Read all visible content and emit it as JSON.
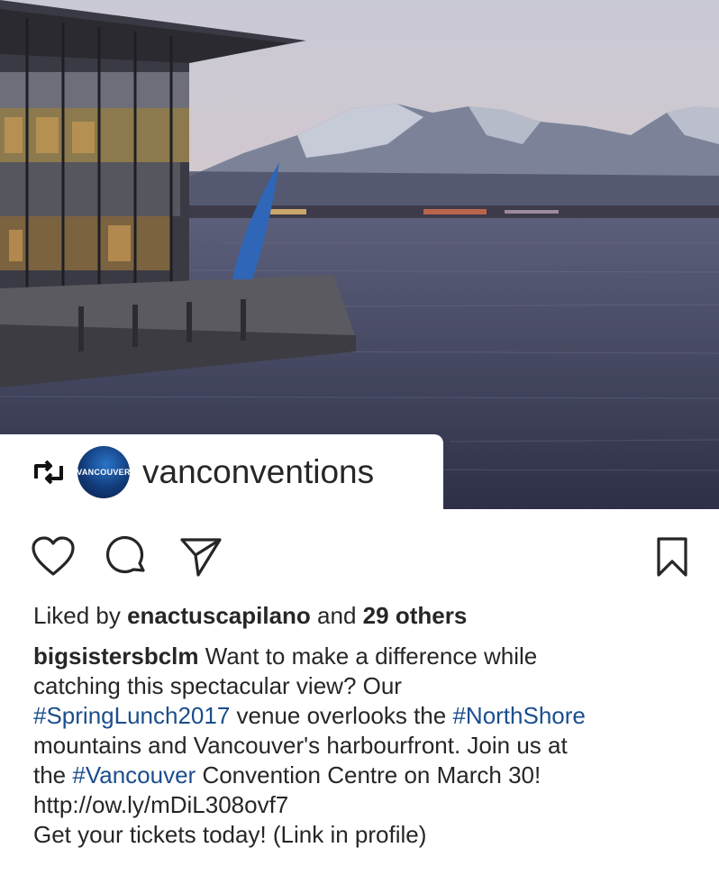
{
  "repost": {
    "username": "vanconventions",
    "avatar_text": "VANCOUVER",
    "icon": "repost-icon"
  },
  "actions": {
    "like_icon": "heart-icon",
    "comment_icon": "comment-icon",
    "share_icon": "share-icon",
    "save_icon": "bookmark-icon"
  },
  "likes": {
    "prefix": "Liked by",
    "user": "enactuscapilano",
    "middle": "and",
    "others": "29 others"
  },
  "caption": {
    "username": "bigsistersbclm",
    "line1_text": " Want to make a difference while",
    "line2": "catching this spectacular view? Our",
    "hashtag1": "#SpringLunch2017",
    "line3_mid": " venue overlooks the ",
    "hashtag2": "#NorthShore",
    "line4": "mountains and Vancouver's harbourfront. Join us at",
    "line5_pre": "the ",
    "hashtag3": "#Vancouver",
    "line5_post": " Convention Centre on March 30!",
    "link": "http://ow.ly/mDiL308ovf7",
    "line7": "Get your tickets today! (Link in profile)"
  },
  "colors": {
    "hashtag": "#1b4e8c",
    "text": "#262626"
  }
}
